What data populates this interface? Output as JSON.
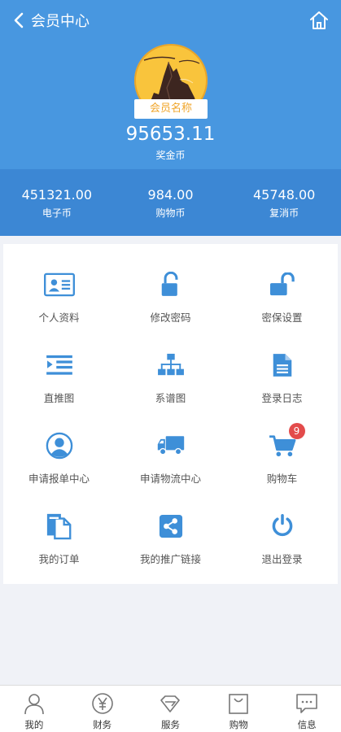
{
  "header": {
    "title": "会员中心",
    "member_name": "会员名称",
    "bonus_value": "95653.11",
    "bonus_label": "奖金币"
  },
  "stats": [
    {
      "value": "451321.00",
      "label": "电子币"
    },
    {
      "value": "984.00",
      "label": "购物币"
    },
    {
      "value": "45748.00",
      "label": "复消币"
    }
  ],
  "menu": [
    {
      "label": "个人资料",
      "icon": "id-card-icon"
    },
    {
      "label": "修改密码",
      "icon": "unlock-icon"
    },
    {
      "label": "密保设置",
      "icon": "unlock-alt-icon"
    },
    {
      "label": "直推图",
      "icon": "indent-list-icon"
    },
    {
      "label": "系谱图",
      "icon": "sitemap-icon"
    },
    {
      "label": "登录日志",
      "icon": "file-text-icon"
    },
    {
      "label": "申请报单中心",
      "icon": "user-circle-icon"
    },
    {
      "label": "申请物流中心",
      "icon": "truck-icon"
    },
    {
      "label": "购物车",
      "icon": "cart-icon",
      "badge": "9"
    },
    {
      "label": "我的订单",
      "icon": "files-icon"
    },
    {
      "label": "我的推广链接",
      "icon": "share-icon"
    },
    {
      "label": "退出登录",
      "icon": "power-icon"
    }
  ],
  "nav": [
    {
      "label": "我的",
      "icon": "user-icon"
    },
    {
      "label": "财务",
      "icon": "yen-icon"
    },
    {
      "label": "服务",
      "icon": "diamond-icon"
    },
    {
      "label": "购物",
      "icon": "bag-icon"
    },
    {
      "label": "信息",
      "icon": "message-icon"
    }
  ],
  "colors": {
    "header_bg": "#4897e0",
    "stats_bg": "#3c87d4",
    "icon_blue": "#3e8fd8",
    "badge_red": "#e34b4b",
    "tag_orange": "#f0a52a"
  }
}
